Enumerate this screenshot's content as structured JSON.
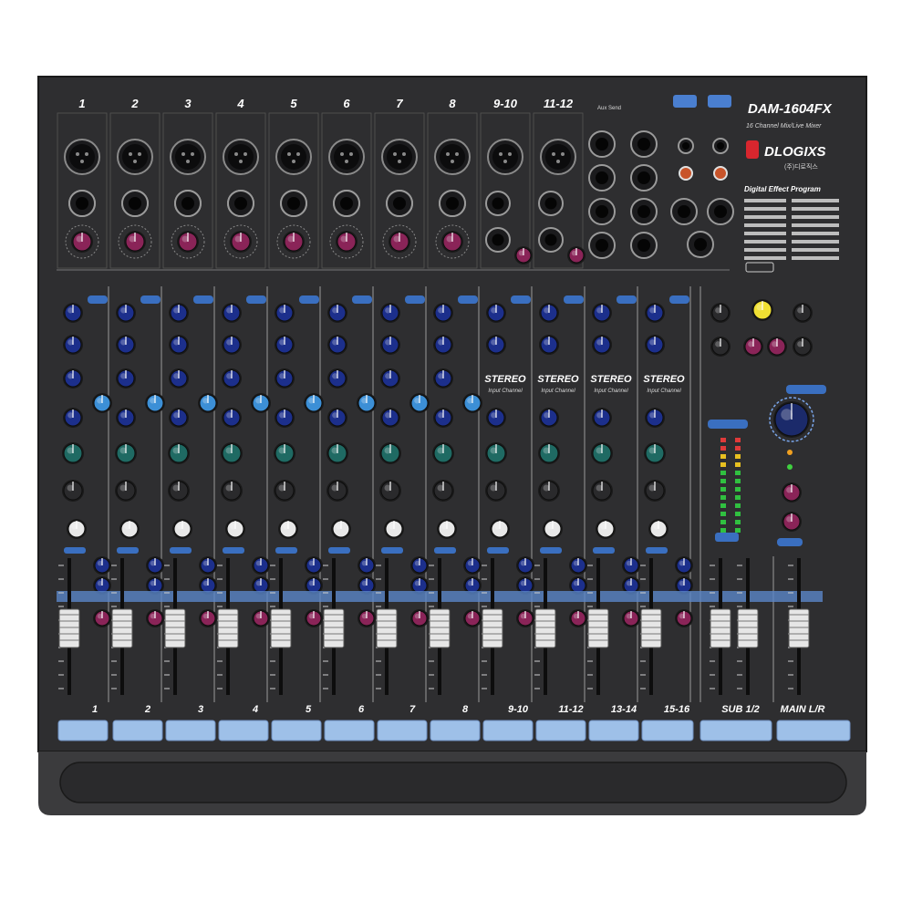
{
  "model": "DAM-1604FX",
  "subtitle": "16 Channel Mix/Live Mixer",
  "brand": "DLOGIXS",
  "brand_sub": "(주)디로직스",
  "dsp_title": "Digital Effect Program",
  "stereo_label": "STEREO",
  "stereo_sub": "Input Channel",
  "top_channel_labels": [
    "1",
    "2",
    "3",
    "4",
    "5",
    "6",
    "7",
    "8",
    "9-10",
    "11-12"
  ],
  "aux_send_label": "Aux Send",
  "bottom_strip_labels": [
    "1",
    "2",
    "3",
    "4",
    "5",
    "6",
    "7",
    "8",
    "9-10",
    "11-12",
    "13-14",
    "15-16",
    "SUB 1/2",
    "MAIN L/R"
  ],
  "colors": {
    "panel": "#2f2f31",
    "knob_blue": "#1c2f8c",
    "knob_light_blue": "#3c8fd6",
    "knob_magenta": "#8a2458",
    "knob_teal": "#1f6a63",
    "knob_yellow": "#f0e033",
    "label_strip": "#9ec0e8"
  }
}
